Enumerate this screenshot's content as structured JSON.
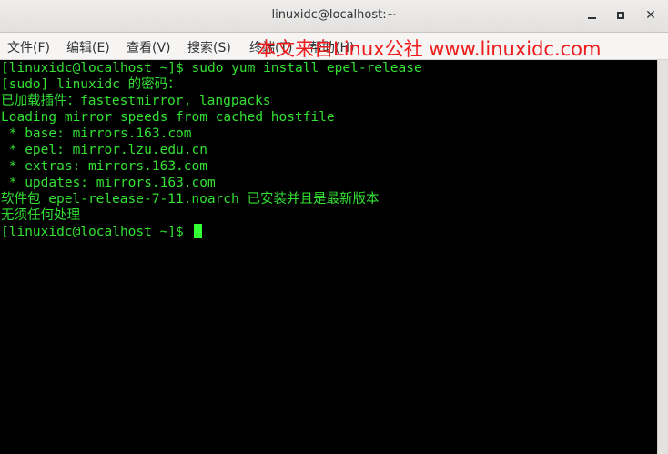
{
  "window": {
    "title": "linuxidc@localhost:~",
    "minimize_label": "",
    "maximize_label": "",
    "close_label": "✕"
  },
  "menu": {
    "items": [
      "文件(F)",
      "编辑(E)",
      "查看(V)",
      "搜索(S)",
      "终端(T)",
      "帮助(H)"
    ]
  },
  "watermark": "本文来自Linux公社 www.linuxidc.com",
  "terminal": {
    "lines": [
      "[linuxidc@localhost ~]$ sudo yum install epel-release",
      "[sudo] linuxidc 的密码：",
      "已加载插件：fastestmirror, langpacks",
      "Loading mirror speeds from cached hostfile",
      " * base: mirrors.163.com",
      " * epel: mirror.lzu.edu.cn",
      " * extras: mirrors.163.com",
      " * updates: mirrors.163.com",
      "软件包 epel-release-7-11.noarch 已安装并且是最新版本",
      "无须任何处理"
    ],
    "prompt": "[linuxidc@localhost ~]$ "
  },
  "colors": {
    "terminal_bg": "#000000",
    "terminal_fg": "#33e033",
    "cursor": "#33ff33",
    "watermark": "#ee1c1c"
  }
}
